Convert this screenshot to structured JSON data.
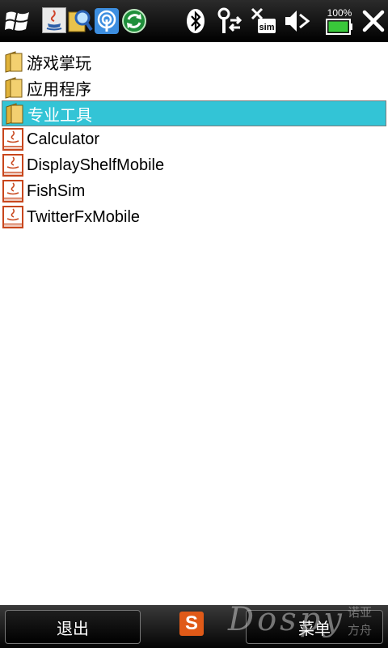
{
  "status_bar": {
    "icons": [
      "windows-start-icon",
      "java-app-icon",
      "search-app-icon",
      "signal-app-icon",
      "sync-app-icon",
      "bluetooth-icon",
      "antenna-data-icon",
      "no-sim-icon",
      "volume-muted-icon",
      "battery-icon",
      "close-icon"
    ],
    "battery_percent": "100%",
    "battery_color": "#39c83a"
  },
  "list": {
    "items": [
      {
        "label": "游戏掌玩",
        "type": "folder"
      },
      {
        "label": "应用程序",
        "type": "folder"
      },
      {
        "label": "专业工具",
        "type": "folder",
        "selected": true
      },
      {
        "label": "Calculator",
        "type": "java-app"
      },
      {
        "label": "DisplayShelfMobile",
        "type": "java-app"
      },
      {
        "label": "FishSim",
        "type": "java-app"
      },
      {
        "label": "TwitterFxMobile",
        "type": "java-app"
      }
    ],
    "selection_color": "#33c4d6"
  },
  "menu_bar": {
    "left_softkey": "退出",
    "right_softkey": "菜单",
    "ime_letter": "S"
  },
  "watermark": {
    "text": "Dospy",
    "cn_line1": "诺亚",
    "cn_line2": "方舟"
  }
}
